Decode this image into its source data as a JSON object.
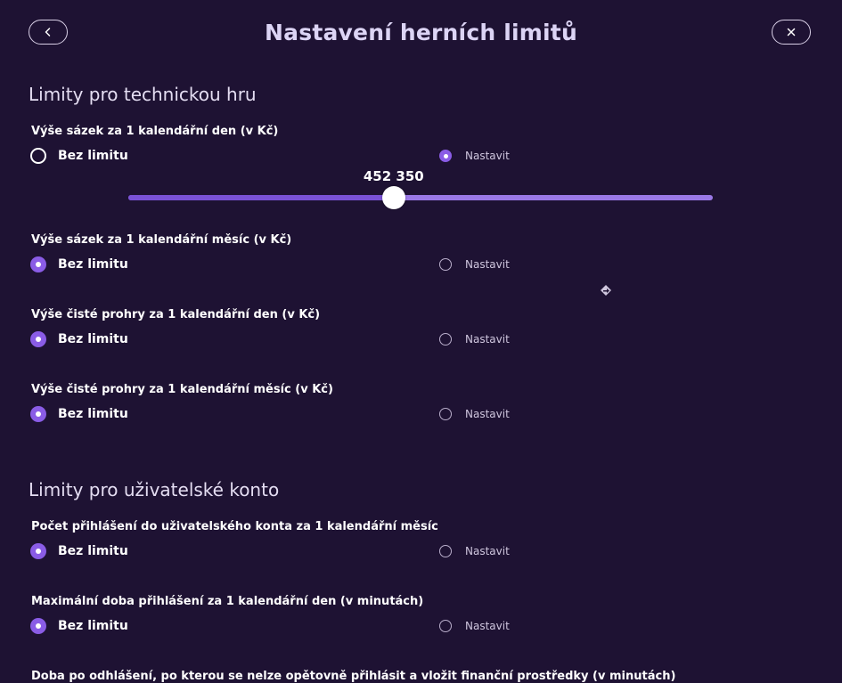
{
  "header": {
    "title": "Nastavení herních limitů",
    "back_icon": "chevron-left-icon",
    "close_icon": "close-icon"
  },
  "sections": [
    {
      "title": "Limity pro technickou hru",
      "items": [
        {
          "label": "Výše sázek za 1 kalendářní den (v Kč)",
          "option_none": "Bez limitu",
          "option_set": "Nastavit",
          "selected": "set",
          "slider_value": "452 350",
          "slider_fraction": 0.454
        },
        {
          "label": "Výše sázek za 1 kalendářní měsíc (v Kč)",
          "option_none": "Bez limitu",
          "option_set": "Nastavit",
          "selected": "none"
        },
        {
          "label": "Výše čisté prohry za 1 kalendářní den (v Kč)",
          "option_none": "Bez limitu",
          "option_set": "Nastavit",
          "selected": "none"
        },
        {
          "label": "Výše čisté prohry za 1 kalendářní měsíc (v Kč)",
          "option_none": "Bez limitu",
          "option_set": "Nastavit",
          "selected": "none"
        }
      ]
    },
    {
      "title": "Limity pro uživatelské konto",
      "items": [
        {
          "label": "Počet přihlášení do uživatelského konta za 1 kalendářní měsíc",
          "option_none": "Bez limitu",
          "option_set": "Nastavit",
          "selected": "none"
        },
        {
          "label": "Maximální doba přihlášení za 1 kalendářní den (v minutách)",
          "option_none": "Bez limitu",
          "option_set": "Nastavit",
          "selected": "none"
        },
        {
          "label": "Doba po odhlášení, po kterou se nelze opětovně přihlásit a vložit finanční prostředky (v minutách)"
        }
      ]
    }
  ],
  "colors": {
    "background": "#1e1233",
    "accent": "#8a5ce6",
    "title": "#dcd4f5"
  }
}
